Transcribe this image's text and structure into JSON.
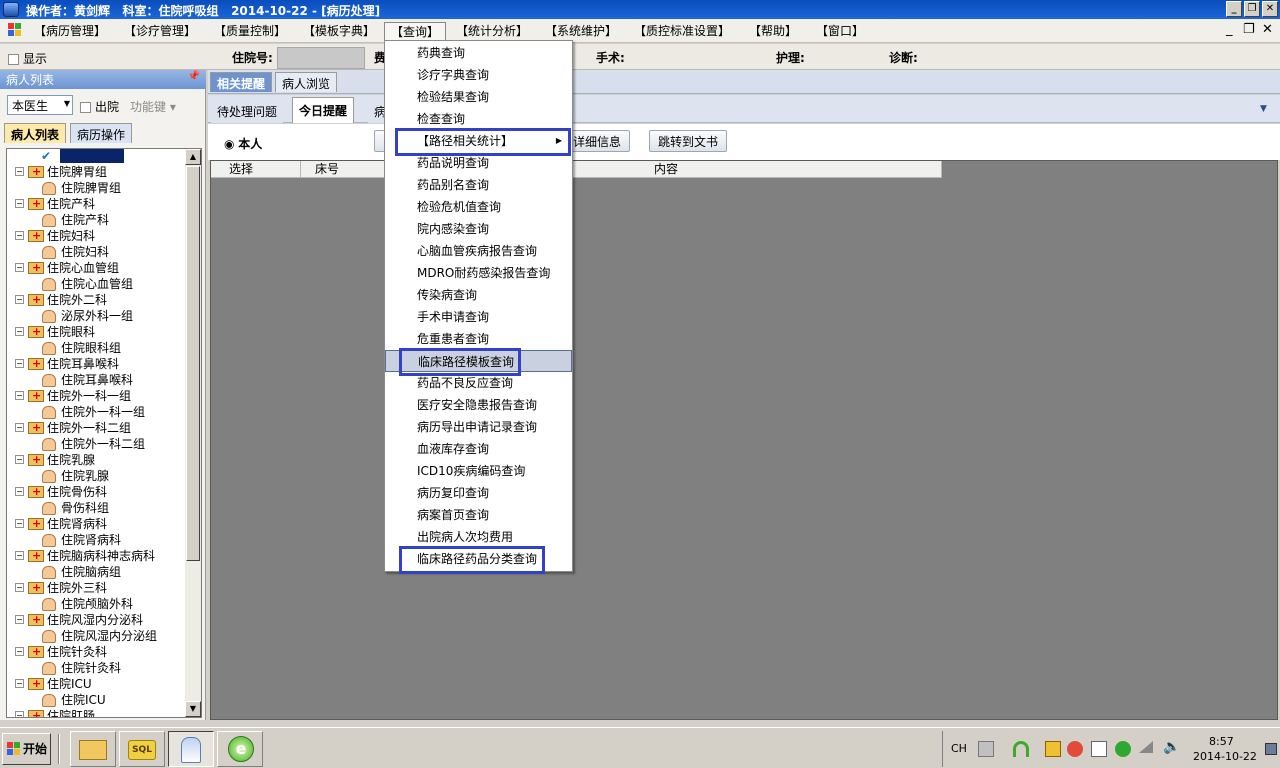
{
  "titlebar": {
    "text": "操作者：黄剑辉   科室：住院呼吸组   2014-10-22 - [病历处理]",
    "controls": [
      "_",
      "❐",
      "✕"
    ]
  },
  "menubar": {
    "items": [
      "【病历管理】",
      "【诊疗管理】",
      "【质量控制】",
      "【模板字典】",
      "【查询】",
      "【统计分析】",
      "【系统维护】",
      "【质控标准设置】",
      "【帮助】",
      "【窗口】"
    ],
    "mdi_controls": [
      "_",
      "❐",
      "✕"
    ]
  },
  "infobar": {
    "show_label": "显示",
    "inpatient_no_label": "住院号:",
    "inpatient_no_value": "",
    "fee_label": "费",
    "surgery_label": "手术:",
    "nursing_label": "护理:",
    "diagnosis_label": "诊断:"
  },
  "left_panel": {
    "title": "病人列表",
    "doctor_combo": "本医生",
    "discharged_label": "出院",
    "function_key_label": "功能键",
    "tabs": [
      "病人列表",
      "病历操作"
    ],
    "tree": [
      {
        "kind": "checked",
        "label": ""
      },
      {
        "kind": "group",
        "label": "住院脾胃组"
      },
      {
        "kind": "child",
        "label": "住院脾胃组"
      },
      {
        "kind": "group",
        "label": "住院产科"
      },
      {
        "kind": "child",
        "label": "住院产科"
      },
      {
        "kind": "group",
        "label": "住院妇科"
      },
      {
        "kind": "child",
        "label": "住院妇科"
      },
      {
        "kind": "group",
        "label": "住院心血管组"
      },
      {
        "kind": "child",
        "label": "住院心血管组"
      },
      {
        "kind": "group",
        "label": "住院外二科"
      },
      {
        "kind": "child",
        "label": "泌尿外科一组"
      },
      {
        "kind": "group",
        "label": "住院眼科"
      },
      {
        "kind": "child",
        "label": "住院眼科组"
      },
      {
        "kind": "group",
        "label": "住院耳鼻喉科"
      },
      {
        "kind": "child",
        "label": "住院耳鼻喉科"
      },
      {
        "kind": "group",
        "label": "住院外一科一组"
      },
      {
        "kind": "child",
        "label": "住院外一科一组"
      },
      {
        "kind": "group",
        "label": "住院外一科二组"
      },
      {
        "kind": "child",
        "label": "住院外一科二组"
      },
      {
        "kind": "group",
        "label": "住院乳腺"
      },
      {
        "kind": "child",
        "label": "住院乳腺"
      },
      {
        "kind": "group",
        "label": "住院骨伤科"
      },
      {
        "kind": "child",
        "label": "骨伤科组"
      },
      {
        "kind": "group",
        "label": "住院肾病科"
      },
      {
        "kind": "child",
        "label": "住院肾病科"
      },
      {
        "kind": "group",
        "label": "住院脑病科神志病科"
      },
      {
        "kind": "child",
        "label": "住院脑病组"
      },
      {
        "kind": "group",
        "label": "住院外三科"
      },
      {
        "kind": "child",
        "label": "住院颅脑外科"
      },
      {
        "kind": "group",
        "label": "住院风湿内分泌科"
      },
      {
        "kind": "child",
        "label": "住院风湿内分泌组"
      },
      {
        "kind": "group",
        "label": "住院针灸科"
      },
      {
        "kind": "child",
        "label": "住院针灸科"
      },
      {
        "kind": "group",
        "label": "住院ICU"
      },
      {
        "kind": "child",
        "label": "住院ICU"
      },
      {
        "kind": "group",
        "label": "住院肛肠"
      }
    ]
  },
  "main": {
    "top_tabs": [
      "相关提醒",
      "病人浏览"
    ],
    "sub_tabs": [
      "待处理问题",
      "今日提醒",
      "病"
    ],
    "radio_label": "本人",
    "detail_button": "详细信息",
    "jump_button": "跳转到文书",
    "grid_columns": [
      "选择",
      "床号",
      "内容"
    ]
  },
  "query_menu": {
    "items": [
      {
        "label": "药典查询"
      },
      {
        "label": "诊疗字典查询"
      },
      {
        "label": "检验结果查询"
      },
      {
        "label": "检查查询"
      },
      {
        "label": "【路径相关统计】",
        "submenu": true,
        "boxed": true
      },
      {
        "label": "药品说明查询"
      },
      {
        "label": "药品别名查询"
      },
      {
        "label": "检验危机值查询"
      },
      {
        "label": "院内感染查询"
      },
      {
        "label": "心脑血管疾病报告查询"
      },
      {
        "label": "MDRO耐药感染报告查询"
      },
      {
        "label": "传染病查询"
      },
      {
        "label": "手术申请查询"
      },
      {
        "label": "危重患者查询"
      },
      {
        "label": "临床路径模板查询",
        "hover": true,
        "boxed": true
      },
      {
        "label": "药品不良反应查询"
      },
      {
        "label": "医疗安全隐患报告查询"
      },
      {
        "label": "病历导出申请记录查询"
      },
      {
        "label": "血液库存查询"
      },
      {
        "label": "ICD10疾病编码查询"
      },
      {
        "label": "病历复印查询"
      },
      {
        "label": "病案首页查询"
      },
      {
        "label": "出院病人次均费用"
      },
      {
        "label": "临床路径药品分类查询",
        "boxed": true
      }
    ],
    "highlight_color": "#3341c7"
  },
  "taskbar": {
    "start_label": "开始",
    "lang": "CH",
    "time": "8:57",
    "date": "2014-10-22",
    "apps": [
      "folder-icon",
      "sql-icon",
      "doctor-app-icon",
      "ie-icon"
    ]
  }
}
